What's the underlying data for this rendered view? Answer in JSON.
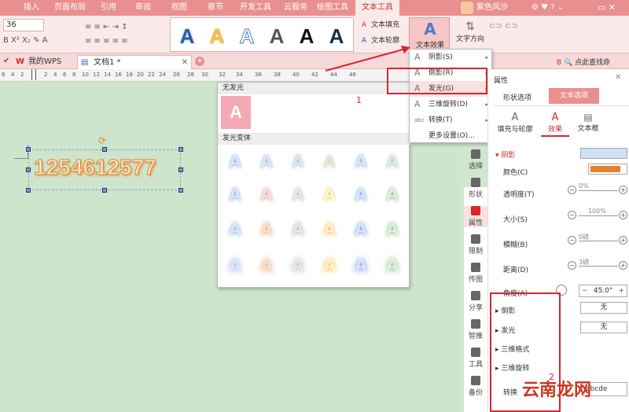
{
  "menu_tabs": [
    "插入",
    "页面布局",
    "引用",
    "审阅",
    "视图",
    "章节",
    "开发工具",
    "云服务",
    "绘图工具",
    "文本工具"
  ],
  "user": {
    "name": "紫色风沙"
  },
  "ribbon": {
    "font_size": "36",
    "text_fill": "文本填充",
    "text_outline": "文本轮廓",
    "text_effect": "文本效果",
    "text_direction": "文字方向",
    "wordart_letters": [
      "A",
      "A",
      "A",
      "A",
      "A",
      "A"
    ]
  },
  "doc_tabs": [
    "我的WPS",
    "文档1 *"
  ],
  "shortcut": "点此查找命",
  "ruler": [
    "6",
    "4",
    "2",
    "2",
    "4",
    "6",
    "8",
    "10",
    "12",
    "14",
    "16",
    "18",
    "20",
    "22",
    "24",
    "26",
    "28",
    "30",
    "32",
    "34",
    "36",
    "38",
    "40",
    "42",
    "44",
    "46"
  ],
  "document": {
    "text": "1254612577"
  },
  "effect_menu": {
    "items": [
      {
        "label": "阴影(S)",
        "icon": "A",
        "arrow": "▸"
      },
      {
        "label": "倒影(R)",
        "icon": "A",
        "arrow": "▸"
      },
      {
        "label": "发光(G)",
        "icon": "A",
        "arrow": "▸"
      },
      {
        "label": "三维旋转(D)",
        "icon": "A",
        "arrow": "▸"
      },
      {
        "label": "转换(T)",
        "icon": "abc",
        "arrow": "▸"
      },
      {
        "label": "更多设置(O)...",
        "icon": "",
        "arrow": ""
      }
    ]
  },
  "glow_panel": {
    "no_glow": "无发光",
    "no_glow_letter": "A",
    "variants": "发光变体",
    "variant_letter": "A",
    "annotation": "1"
  },
  "annotation_2": "2",
  "panel": {
    "title": "属性",
    "tabs": [
      "形状选项",
      "文本选项"
    ],
    "subtabs": [
      "填充与轮廓",
      "效果",
      "文本框"
    ],
    "section": "阴影",
    "rows": [
      {
        "label": "颜色(C)"
      },
      {
        "label": "透明度(T)",
        "value": "0%"
      },
      {
        "label": "大小(S)",
        "value": "100%"
      },
      {
        "label": "模糊(B)",
        "value": "0磅"
      },
      {
        "label": "距离(D)",
        "value": "3磅"
      }
    ],
    "angle_label": "角度(A)",
    "angle_value": "45.0°",
    "collapsed": [
      {
        "label": "倒影",
        "value": "无"
      },
      {
        "label": "发光",
        "value": "无"
      },
      {
        "label": "三维格式"
      },
      {
        "label": "三维旋转"
      }
    ],
    "transform_label": "转换",
    "transform_value": "abcde"
  },
  "sidebar": [
    "选择",
    "形状",
    "属性",
    "限制",
    "传图",
    "分享",
    "智推",
    "工具",
    "备份"
  ],
  "watermark": "云南龙网",
  "colors": {
    "accent": "#e98f8f",
    "highlight": "#d9262b",
    "shadow_color": "#e8802a"
  }
}
